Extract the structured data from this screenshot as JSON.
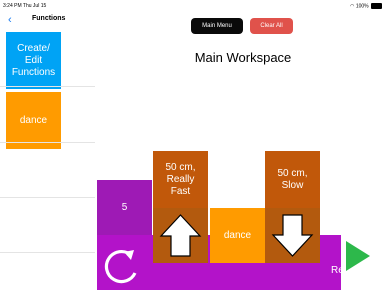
{
  "status_bar": {
    "time_date": "3:24 PM   Thu Jul 15",
    "battery": "100%"
  },
  "sidebar": {
    "back_icon": "chevron-left",
    "title": "Functions",
    "items": [
      {
        "label": "Create/\nEdit\nFunctions",
        "color": "#00a3f5"
      },
      {
        "label": "dance",
        "color": "#ff9b00"
      }
    ]
  },
  "main": {
    "main_menu_label": "Main Menu",
    "clear_all_label": "Clear All",
    "workspace_title": "Main Workspace",
    "blocks": {
      "repeat_count": "5",
      "fast_label": "50 cm,\nReally\nFast",
      "slow_label": "50 cm,\nSlow",
      "dance_label": "dance",
      "repeat_label": "Re"
    },
    "colors": {
      "repeat": "#b313c9",
      "move": "#c1580a",
      "function": "#ff9b00",
      "play": "#2db84b"
    }
  }
}
